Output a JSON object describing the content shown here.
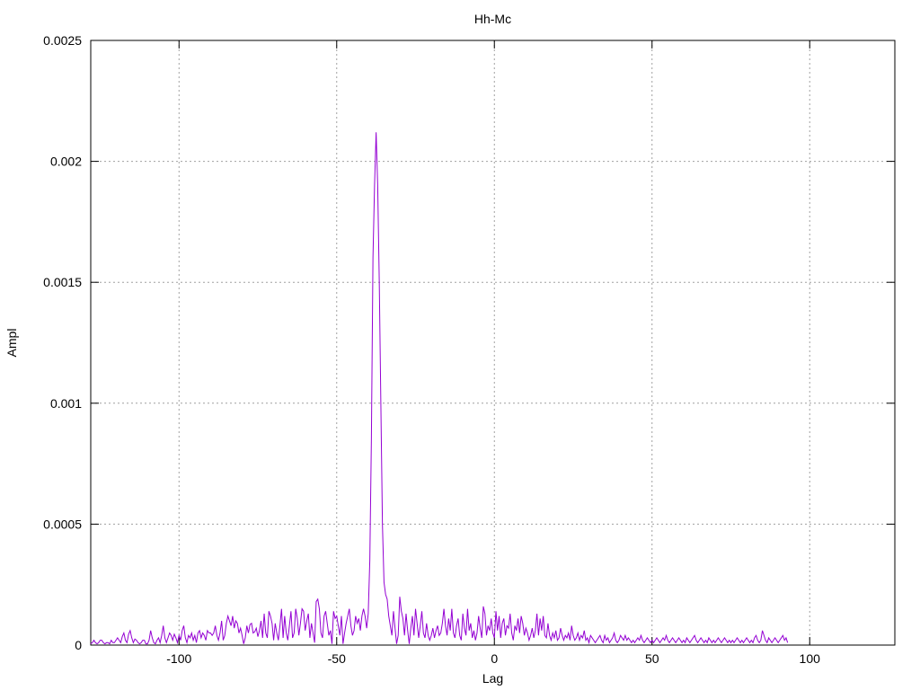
{
  "chart_data": {
    "type": "line",
    "title": "Hh-Mc",
    "xlabel": "Lag",
    "ylabel": "Ampl",
    "xlim": [
      -128,
      127
    ],
    "ylim": [
      0,
      0.0025
    ],
    "x_ticks": [
      -100,
      -50,
      0,
      50,
      100
    ],
    "x_tick_labels": [
      "-100",
      "-50",
      "0",
      "50",
      "100"
    ],
    "y_ticks": [
      0,
      0.0005,
      0.001,
      0.0015,
      0.002,
      0.0025
    ],
    "y_tick_labels": [
      "0",
      "0.0005",
      "0.001",
      "0.0015",
      "0.002",
      "0.0025"
    ],
    "grid": true,
    "series": [
      {
        "color": "#9400d3",
        "x_start": -128,
        "x_step": 0.5,
        "values": [
          5e-06,
          1e-05,
          2e-05,
          1e-05,
          5e-06,
          1e-05,
          2e-05,
          2e-05,
          1e-05,
          5e-06,
          1e-05,
          1e-05,
          5e-06,
          2e-05,
          1e-05,
          1e-05,
          2e-05,
          3e-05,
          2e-05,
          1e-05,
          3.5e-05,
          5e-05,
          2e-05,
          1e-05,
          4.5e-05,
          6e-05,
          3e-05,
          1e-05,
          2.5e-05,
          2e-05,
          1e-05,
          5e-06,
          1e-05,
          2e-05,
          2e-05,
          5e-06,
          5e-06,
          2e-05,
          6e-05,
          3e-05,
          1e-05,
          5e-06,
          2e-05,
          3e-05,
          1e-05,
          4e-05,
          8e-05,
          3e-05,
          1e-05,
          3e-05,
          5e-05,
          4e-05,
          2e-05,
          4.5e-05,
          3e-05,
          1e-05,
          4e-05,
          2e-05,
          6e-05,
          8e-05,
          3e-05,
          1e-05,
          4e-05,
          3e-05,
          5e-05,
          2e-05,
          4e-05,
          1e-05,
          5e-05,
          6e-05,
          3e-05,
          5e-05,
          4e-05,
          2e-05,
          6e-05,
          5e-05,
          5e-05,
          4e-05,
          5e-05,
          8e-05,
          4e-05,
          2e-05,
          5e-05,
          0.0001,
          2e-05,
          4e-05,
          9e-05,
          0.00012,
          0.0001,
          8e-05,
          0.00012,
          7e-05,
          0.0001,
          9e-05,
          5e-05,
          7e-05,
          4e-05,
          5e-06,
          3e-05,
          8e-05,
          5e-05,
          8.5e-05,
          9e-05,
          5e-05,
          5.5e-05,
          7e-05,
          3.5e-05,
          6e-05,
          0.0001,
          3e-05,
          0.00013,
          5e-05,
          3e-05,
          0.00014,
          0.00012,
          9e-05,
          2e-05,
          9e-05,
          5e-05,
          2e-05,
          8e-05,
          0.00015,
          3e-05,
          0.00012,
          5e-05,
          2e-05,
          8e-05,
          0.00014,
          3e-05,
          5e-05,
          0.00015,
          0.00011,
          4e-05,
          9e-05,
          0.00015,
          0.00014,
          6e-05,
          0.0001,
          0.00013,
          3e-05,
          9e-05,
          5e-05,
          1e-05,
          0.00018,
          0.00019,
          0.00015,
          5e-05,
          3e-05,
          0.00012,
          0.00014,
          9e-05,
          4e-05,
          6e-05,
          5e-06,
          0.00014,
          0.00011,
          0.00012,
          8e-05,
          4e-05,
          0.00012,
          5e-06,
          5e-05,
          9e-05,
          0.00012,
          0.00015,
          8e-05,
          4e-05,
          6e-05,
          0.00012,
          9e-05,
          0.00011,
          6e-05,
          0.00012,
          0.00015,
          0.00012,
          7e-05,
          0.00013,
          0.00035,
          0.00085,
          0.0016,
          0.0019,
          0.00212,
          0.0019,
          0.0015,
          0.001,
          0.0005,
          0.00026,
          0.00021,
          0.00019,
          0.00012,
          8e-05,
          4e-05,
          0.00014,
          7e-05,
          5e-06,
          4e-05,
          0.0002,
          0.00014,
          0.00011,
          4e-05,
          0.00013,
          6e-05,
          5e-06,
          7e-05,
          0.00012,
          4e-05,
          0.00015,
          9e-05,
          3e-05,
          8e-05,
          0.00014,
          5e-05,
          3e-05,
          9e-05,
          4e-05,
          2e-05,
          4e-05,
          7e-05,
          3e-05,
          6e-05,
          8e-05,
          4e-05,
          5e-05,
          9e-05,
          0.00015,
          8e-05,
          4e-05,
          0.00011,
          6e-05,
          0.00015,
          5e-05,
          3e-05,
          8e-05,
          0.00011,
          4e-05,
          2e-05,
          0.00013,
          7e-05,
          4e-05,
          0.00015,
          6e-05,
          9e-05,
          3e-05,
          6e-05,
          2e-05,
          5e-05,
          0.00012,
          7e-05,
          3e-05,
          0.00016,
          0.00013,
          4e-05,
          8e-05,
          6e-05,
          0.00011,
          5e-05,
          3e-05,
          0.00014,
          6e-05,
          0.00012,
          3e-05,
          9e-05,
          0.00011,
          4e-05,
          8e-05,
          7e-05,
          0.00013,
          5e-05,
          2e-05,
          8e-05,
          6e-05,
          0.00011,
          5e-05,
          0.00012,
          9e-05,
          4e-05,
          7e-05,
          5e-05,
          2e-05,
          4e-05,
          7e-05,
          3e-05,
          6e-05,
          0.00013,
          4e-05,
          0.00011,
          6e-05,
          0.00012,
          4e-05,
          3e-05,
          9e-05,
          4e-05,
          2e-05,
          5e-05,
          3e-05,
          6e-05,
          2e-05,
          3e-05,
          7e-05,
          4e-05,
          2e-05,
          4e-05,
          3e-05,
          5e-05,
          2e-05,
          8e-05,
          4e-05,
          2e-05,
          3e-05,
          5e-05,
          2e-05,
          4e-05,
          3e-05,
          6e-05,
          2e-05,
          3e-05,
          1e-05,
          4e-05,
          3e-05,
          2e-05,
          1e-05,
          2e-05,
          3e-05,
          4e-05,
          2e-05,
          1e-05,
          4e-05,
          2e-05,
          3e-05,
          1e-05,
          2e-05,
          3e-05,
          5e-05,
          2e-05,
          1e-05,
          2e-05,
          4e-05,
          3e-05,
          2e-05,
          4e-05,
          2e-05,
          3e-05,
          2e-05,
          1e-05,
          2e-05,
          1e-05,
          2e-05,
          3e-05,
          2e-05,
          4e-05,
          2e-05,
          1e-05,
          2e-05,
          3e-05,
          2e-05,
          1e-05,
          2e-05,
          1e-05,
          2e-05,
          3e-05,
          2e-05,
          1e-05,
          2e-05,
          3e-05,
          2e-05,
          4e-05,
          2e-05,
          1e-05,
          2e-05,
          3e-05,
          2e-05,
          1e-05,
          2e-05,
          3e-05,
          2e-05,
          1e-05,
          2e-05,
          1e-05,
          3e-05,
          2e-05,
          1e-05,
          2e-05,
          3e-05,
          4e-05,
          2e-05,
          1e-05,
          2e-05,
          3e-05,
          2e-05,
          1e-05,
          2e-05,
          1e-05,
          3e-05,
          2e-05,
          1e-05,
          2e-05,
          1e-05,
          2e-05,
          3e-05,
          2e-05,
          1e-05,
          2e-05,
          3e-05,
          2e-05,
          1e-05,
          2e-05,
          1e-05,
          2e-05,
          1e-05,
          2e-05,
          3e-05,
          2e-05,
          1e-05,
          2e-05,
          1e-05,
          2e-05,
          3e-05,
          2e-05,
          1e-05,
          2e-05,
          1e-05,
          3e-05,
          4e-05,
          2e-05,
          1e-05,
          2e-05,
          6e-05,
          4e-05,
          2e-05,
          1e-05,
          3e-05,
          2e-05,
          1e-05,
          2e-05,
          3e-05,
          2e-05,
          1e-05,
          2e-05,
          3e-05,
          4e-05,
          2e-05,
          3e-05,
          1e-05
        ]
      }
    ]
  }
}
